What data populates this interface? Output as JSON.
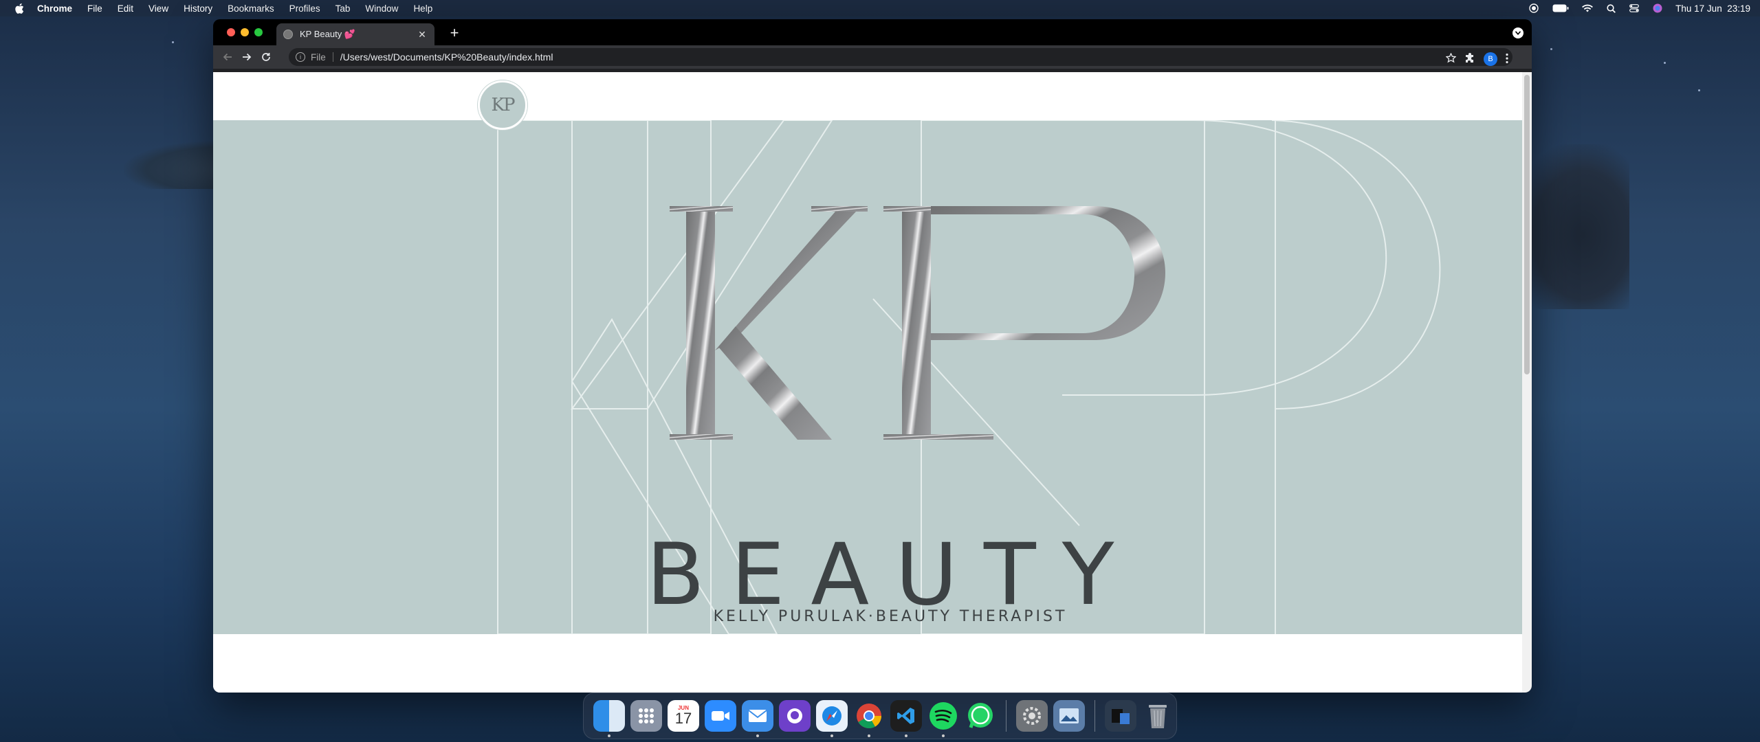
{
  "menubar": {
    "app": "Chrome",
    "items": [
      "File",
      "Edit",
      "View",
      "History",
      "Bookmarks",
      "Profiles",
      "Tab",
      "Window",
      "Help"
    ],
    "clock": "Thu 17 Jun  23:19"
  },
  "browser": {
    "tab_title": "KP Beauty 💕",
    "address_scheme": "File",
    "address_url": "/Users/west/Documents/KP%20Beauty/index.html",
    "profile_initial": "B"
  },
  "page": {
    "small_logo_text": "KP",
    "hero_monogram": "KP",
    "hero_brand": "BEAUTY",
    "hero_tagline": "KELLY PURULAK·BEAUTY THERAPIST",
    "hero_bg": "#bccdcc"
  },
  "dock": {
    "calendar_month": "JUN",
    "calendar_day": "17"
  }
}
